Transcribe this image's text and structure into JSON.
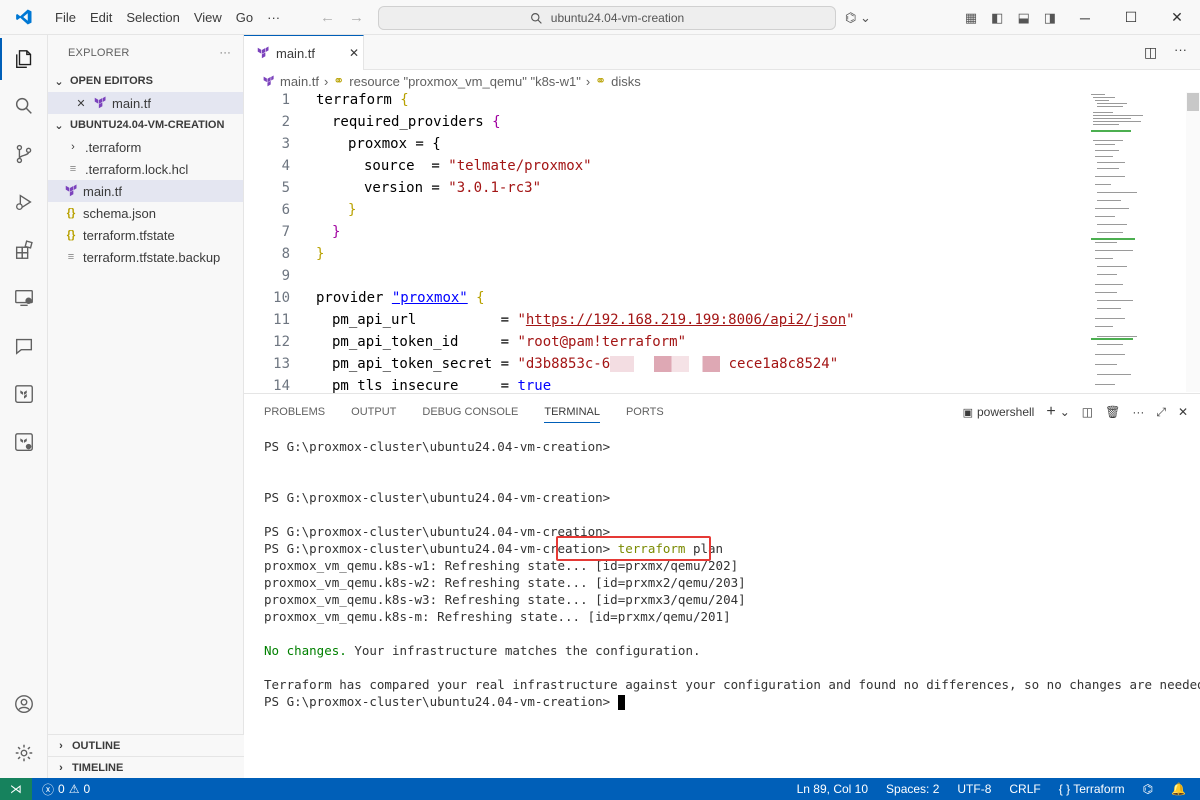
{
  "menu": [
    "File",
    "Edit",
    "Selection",
    "View",
    "Go",
    "···"
  ],
  "search": {
    "text": "ubuntu24.04-vm-creation"
  },
  "explorer": {
    "title": "EXPLORER",
    "more": "···",
    "open_editors": "OPEN EDITORS",
    "open_file": "main.tf",
    "folder": "UBUNTU24.04-VM-CREATION",
    "files": [
      ".terraform",
      ".terraform.lock.hcl",
      "main.tf",
      "schema.json",
      "terraform.tfstate",
      "terraform.tfstate.backup"
    ],
    "outline": "OUTLINE",
    "timeline": "TIMELINE"
  },
  "tab": {
    "label": "main.tf",
    "close": "✕"
  },
  "breadcrumb": {
    "file": "main.tf",
    "resource": "resource \"proxmox_vm_qemu\" \"k8s-w1\"",
    "disks": "disks"
  },
  "code": {
    "lines": [
      "1",
      "2",
      "3",
      "4",
      "5",
      "6",
      "7",
      "8",
      "9",
      "10",
      "11",
      "12",
      "13",
      "14"
    ],
    "terraform": "terraform",
    "required_providers": "required_providers",
    "proxmox": "proxmox = {",
    "source_key": "source  = ",
    "source_val": "\"telmate/proxmox\"",
    "version_key": "version = ",
    "version_val": "\"3.0.1-rc3\"",
    "provider": "provider",
    "provider_name": "\"proxmox\"",
    "api_url_key": "pm_api_url          = ",
    "api_url_val": "\"https://192.168.219.199:8006/api2/json\"",
    "token_id_key": "pm_api_token_id     = ",
    "token_id_val": "\"root@pam!terraform\"",
    "secret_key": "pm_api_token_secret = ",
    "secret_val_a": "\"d3b8853c-6",
    "secret_val_b": "cece1a8c8524\"",
    "tls_key": "pm_tls_insecure     = ",
    "tls_val": "true"
  },
  "panel": {
    "tabs": [
      "PROBLEMS",
      "OUTPUT",
      "DEBUG CONSOLE",
      "TERMINAL",
      "PORTS"
    ],
    "shell": "powershell"
  },
  "terminal": {
    "prompt": "PS G:\\proxmox-cluster\\ubuntu24.04-vm-creation>",
    "cmd": "terraform",
    "cmd_arg": "plan",
    "refresh": [
      "proxmox_vm_qemu.k8s-w1: Refreshing state... [id=prxmx/qemu/202]",
      "proxmox_vm_qemu.k8s-w2: Refreshing state... [id=prxmx2/qemu/203]",
      "proxmox_vm_qemu.k8s-w3: Refreshing state... [id=prxmx3/qemu/204]",
      "proxmox_vm_qemu.k8s-m: Refreshing state... [id=prxmx/qemu/201]"
    ],
    "no_changes": "No changes.",
    "no_changes_rest": " Your infrastructure matches the configuration.",
    "compare": "Terraform has compared your real infrastructure against your configuration and found no differences, so no changes are needed."
  },
  "status": {
    "errors": "0",
    "warnings": "0",
    "position": "Ln 89, Col 10",
    "spaces": "Spaces: 2",
    "encoding": "UTF-8",
    "eol": "CRLF",
    "language": "Terraform"
  },
  "colors": {
    "accent": "#005fb8",
    "terraform": "#7b42bc",
    "string": "#a31515",
    "keyword": "#0000ff",
    "highlight": "#e53935"
  }
}
